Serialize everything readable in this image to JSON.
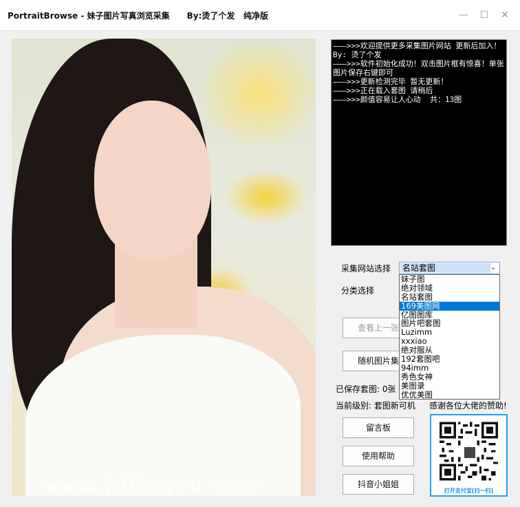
{
  "window": {
    "title": "PortraitBrowse - 妹子图片写真浏览采集      By:烫了个发   纯净版",
    "minimize": "—",
    "maximize": "☐",
    "close": "✕"
  },
  "photo": {
    "watermark": "www.jdlingyu.com"
  },
  "console": {
    "lines": [
      "———>>>欢迎提供更多采集图片网站 更新后加入！ By: 烫了个发",
      "———>>>软件初始化成功！双击图片框有惊喜！单张图片保存右键即可",
      "———>>>更新检测完毕 暂无更新！",
      "———>>>正在载入套图 请稍后",
      "———>>>颜值容易让人心动  共：13图"
    ]
  },
  "controls": {
    "site_label": "采集网站选择",
    "category_label": "分类选择",
    "site_selected": "名站套图",
    "site_options": [
      "妹子图",
      "绝对领域",
      "名站套图",
      "169美图网",
      "亿图图库",
      "图片吧套图",
      "Luzimm",
      "xxxiao",
      "绝对服从",
      "192套图吧",
      "94imm",
      "秀色女神",
      "美图录",
      "优优美图"
    ],
    "highlighted_option": "169美图网",
    "prev_button": "查看上一张",
    "random_button": "随机图片集",
    "saved_text": "已保存套图: 0张",
    "level_text": "当前级别: 套图新可机",
    "thanks_text": "感谢各位大佬的赞助!",
    "message_button": "留言板",
    "help_button": "使用帮助",
    "douyin_button": "抖音小姐姐",
    "qr_caption": "打开支付宝[扫一扫]"
  }
}
